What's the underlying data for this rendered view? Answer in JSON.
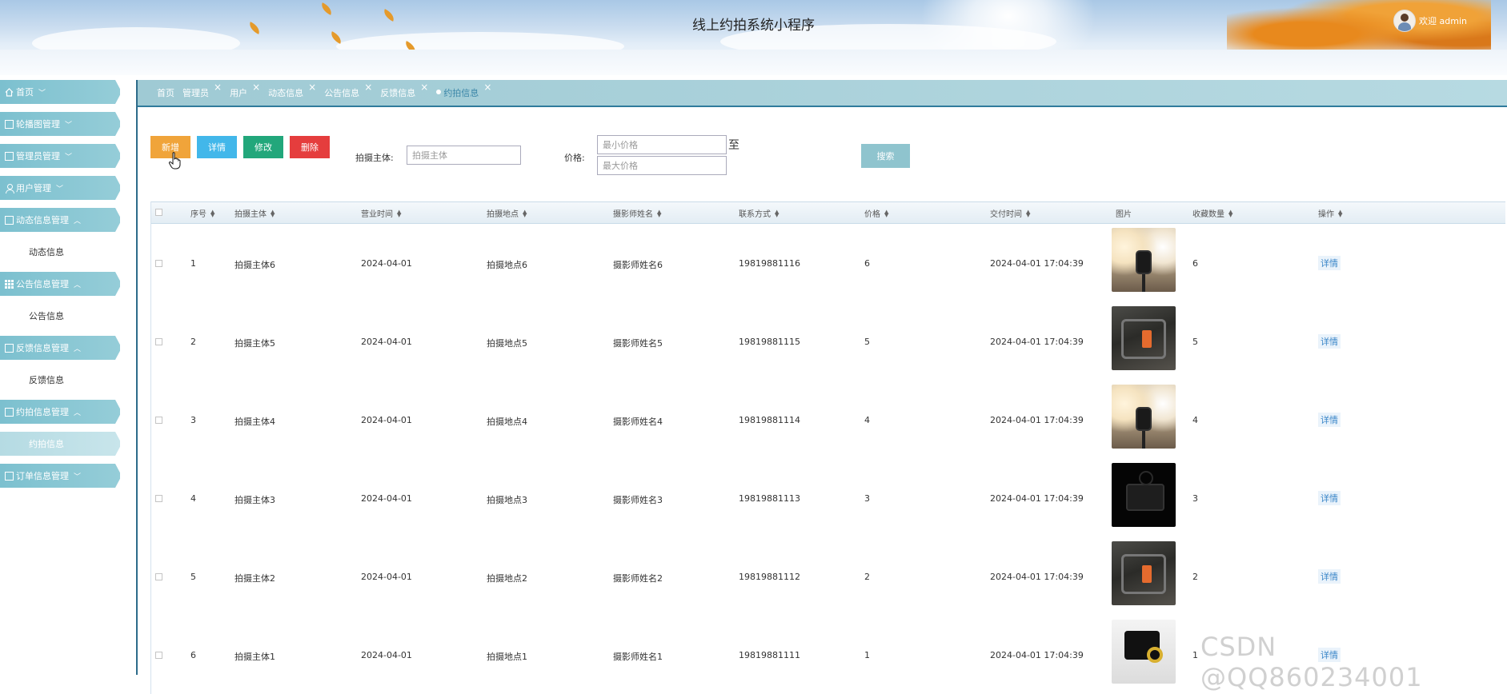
{
  "header": {
    "title": "线上约拍系统小程序",
    "welcome": "欢迎 admin"
  },
  "sidebar": {
    "items": [
      {
        "label": "首页",
        "icon": "home-icon",
        "expanded": false
      },
      {
        "label": "轮播图管理",
        "icon": "square-icon",
        "expanded": false
      },
      {
        "label": "管理员管理",
        "icon": "square-icon",
        "expanded": false
      },
      {
        "label": "用户管理",
        "icon": "user-icon",
        "expanded": false
      },
      {
        "label": "动态信息管理",
        "icon": "document-icon",
        "expanded": true,
        "sub": "动态信息"
      },
      {
        "label": "公告信息管理",
        "icon": "grid-icon",
        "expanded": true,
        "sub": "公告信息"
      },
      {
        "label": "反馈信息管理",
        "icon": "gift-icon",
        "expanded": true,
        "sub": "反馈信息"
      },
      {
        "label": "约拍信息管理",
        "icon": "gift-icon",
        "expanded": true,
        "sub": "约拍信息"
      },
      {
        "label": "订单信息管理",
        "icon": "square-icon",
        "expanded": false
      }
    ]
  },
  "tabs": [
    {
      "label": "首页",
      "closable": false
    },
    {
      "label": "管理员",
      "closable": true
    },
    {
      "label": "用户",
      "closable": true
    },
    {
      "label": "动态信息",
      "closable": true
    },
    {
      "label": "公告信息",
      "closable": true
    },
    {
      "label": "反馈信息",
      "closable": true
    },
    {
      "label": "约拍信息",
      "closable": true,
      "active": true
    }
  ],
  "toolbar": {
    "add": "新增",
    "detail": "详情",
    "edit": "修改",
    "delete": "删除"
  },
  "search": {
    "subject_label": "拍摄主体:",
    "subject_placeholder": "拍摄主体",
    "price_label": "价格:",
    "min_price_placeholder": "最小价格",
    "max_price_placeholder": "最大价格",
    "to_label": "至",
    "button": "搜索"
  },
  "table": {
    "headers": [
      "序号",
      "拍摄主体",
      "营业时间",
      "拍摄地点",
      "摄影师姓名",
      "联系方式",
      "价格",
      "交付时间",
      "图片",
      "收藏数量",
      "操作"
    ],
    "action_label": "详情",
    "rows": [
      {
        "no": "1",
        "subject": "拍摄主体6",
        "hours": "2024-04-01",
        "location": "拍摄地点6",
        "photographer": "摄影师姓名6",
        "phone": "19819881116",
        "price": "6",
        "delivery": "2024-04-01 17:04:39",
        "image": "studio-photo",
        "favorites": "6"
      },
      {
        "no": "2",
        "subject": "拍摄主体5",
        "hours": "2024-04-01",
        "location": "拍摄地点5",
        "photographer": "摄影师姓名5",
        "phone": "19819881115",
        "price": "5",
        "delivery": "2024-04-01 17:04:39",
        "image": "gear-photo",
        "favorites": "5"
      },
      {
        "no": "3",
        "subject": "拍摄主体4",
        "hours": "2024-04-01",
        "location": "拍摄地点4",
        "photographer": "摄影师姓名4",
        "phone": "19819881114",
        "price": "4",
        "delivery": "2024-04-01 17:04:39",
        "image": "studio-photo",
        "favorites": "4"
      },
      {
        "no": "4",
        "subject": "拍摄主体3",
        "hours": "2024-04-01",
        "location": "拍摄地点3",
        "photographer": "摄影师姓名3",
        "phone": "19819881113",
        "price": "3",
        "delivery": "2024-04-01 17:04:39",
        "image": "dark-camera-photo",
        "favorites": "3"
      },
      {
        "no": "5",
        "subject": "拍摄主体2",
        "hours": "2024-04-01",
        "location": "拍摄地点2",
        "photographer": "摄影师姓名2",
        "phone": "19819881112",
        "price": "2",
        "delivery": "2024-04-01 17:04:39",
        "image": "gear-photo",
        "favorites": "2"
      },
      {
        "no": "6",
        "subject": "拍摄主体1",
        "hours": "2024-04-01",
        "location": "拍摄地点1",
        "photographer": "摄影师姓名1",
        "phone": "19819881111",
        "price": "1",
        "delivery": "2024-04-01 17:04:39",
        "image": "camera-rig-photo",
        "favorites": "1"
      }
    ]
  },
  "watermark": "CSDN @QQ860234001"
}
